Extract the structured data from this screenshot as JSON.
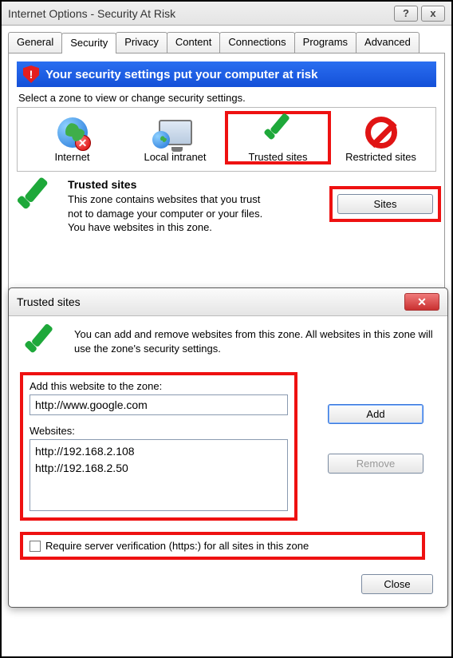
{
  "window": {
    "title": "Internet Options - Security At Risk",
    "help": "?",
    "close": "x"
  },
  "tabs": {
    "general": "General",
    "security": "Security",
    "privacy": "Privacy",
    "content": "Content",
    "connections": "Connections",
    "programs": "Programs",
    "advanced": "Advanced"
  },
  "warning": "Your security settings put your computer at risk",
  "zone_prompt": "Select a zone to view or change security settings.",
  "zones": {
    "internet": "Internet",
    "intranet": "Local intranet",
    "trusted": "Trusted sites",
    "restricted": "Restricted sites"
  },
  "trusted": {
    "heading": "Trusted sites",
    "desc1": "This zone contains websites that you trust not to damage your computer or your files.",
    "desc2": "You have websites in this zone."
  },
  "sites_button": "Sites",
  "dialog2": {
    "title": "Trusted sites",
    "info": "You can add and remove websites from this zone. All websites in this zone will use the zone's security settings.",
    "add_label": "Add this website to the zone:",
    "add_value": "http://www.google.com",
    "add_button": "Add",
    "websites_label": "Websites:",
    "websites": [
      "http://192.168.2.108",
      "http://192.168.2.50"
    ],
    "remove_button": "Remove",
    "require_label": "Require server verification (https:) for all sites in this zone",
    "close_button": "Close"
  }
}
